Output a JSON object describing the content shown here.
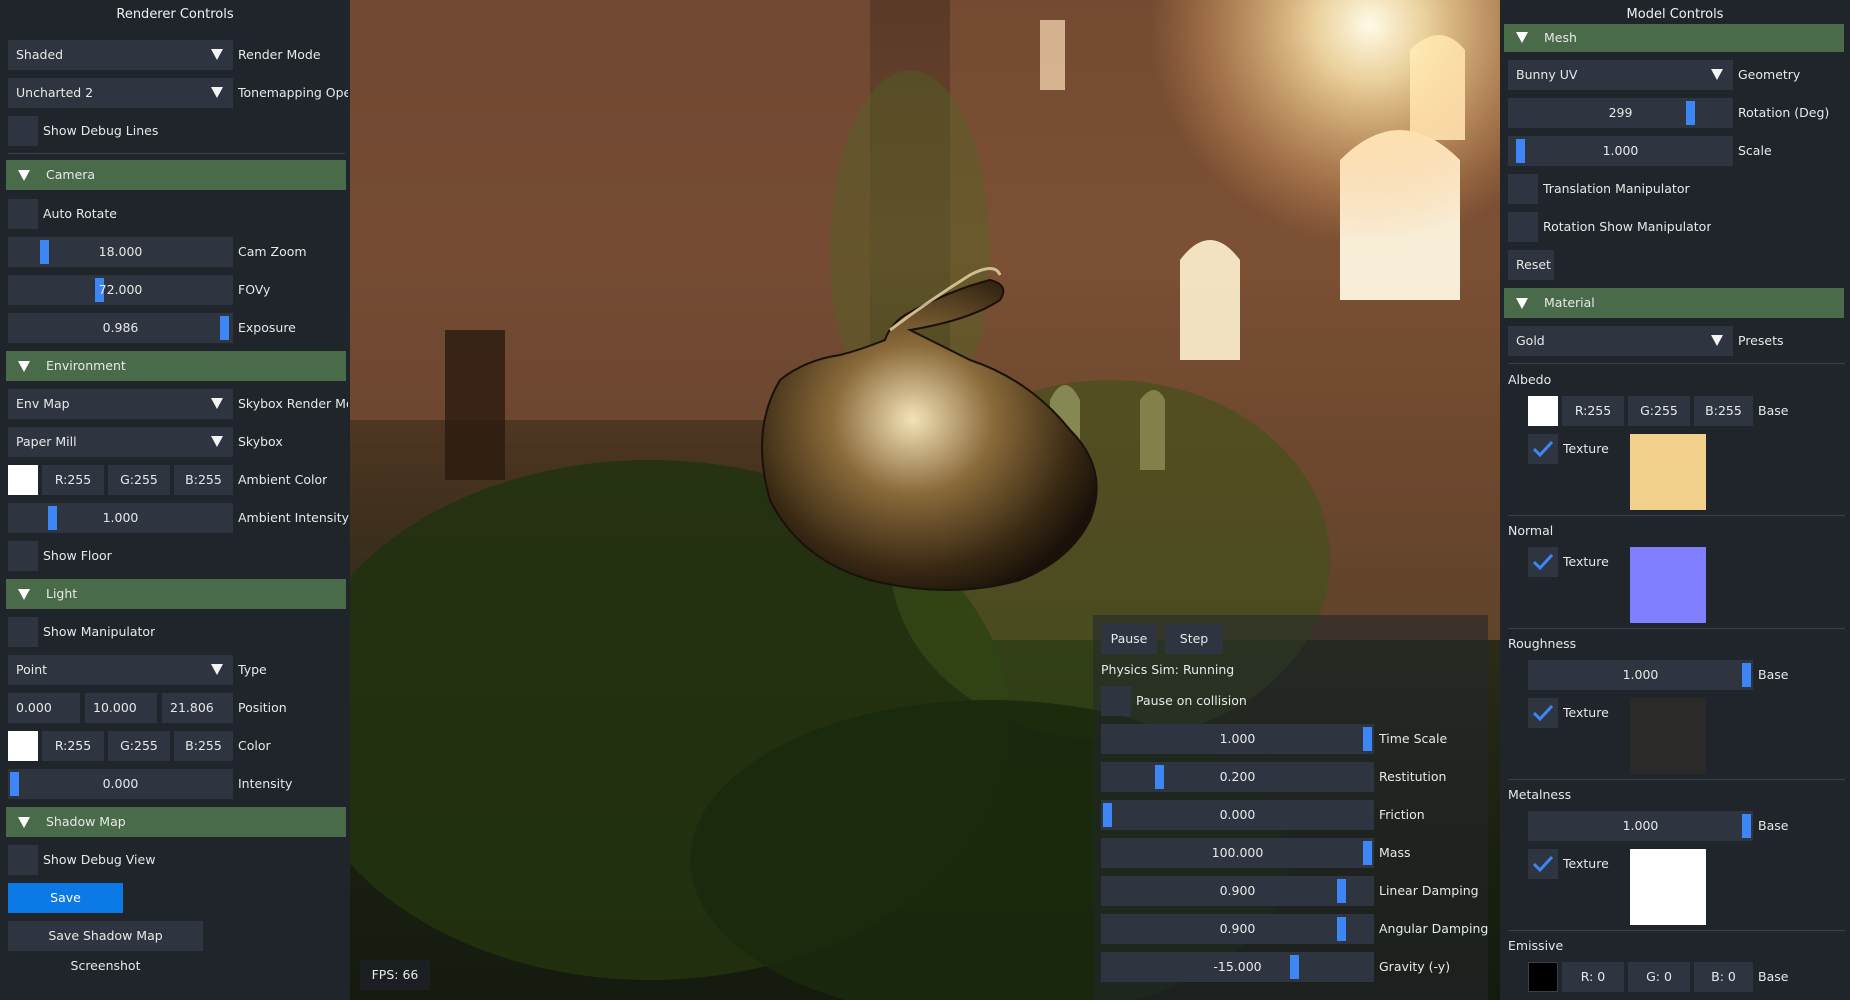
{
  "left": {
    "title": "Renderer Controls",
    "render_mode": {
      "value": "Shaded",
      "label": "Render Mode"
    },
    "tonemapping": {
      "value": "Uncharted 2",
      "label": "Tonemapping Ope"
    },
    "debug_lines": "Show Debug Lines",
    "camera": {
      "header": "Camera",
      "auto_rotate": "Auto Rotate",
      "zoom": {
        "value": "18.000",
        "label": "Cam Zoom",
        "fraction": 0.14
      },
      "fovy": {
        "value": "72.000",
        "label": "FOVy",
        "fraction": 0.4
      },
      "exposure": {
        "value": "0.986",
        "label": "Exposure",
        "fraction": 0.99
      }
    },
    "environment": {
      "header": "Environment",
      "skybox_mode": {
        "value": "Env Map",
        "label": "Skybox Render Mo"
      },
      "skybox": {
        "value": "Paper Mill",
        "label": "Skybox"
      },
      "ambient": {
        "r": "R:255",
        "g": "G:255",
        "b": "B:255",
        "label": "Ambient Color"
      },
      "ambient_intensity": {
        "value": "1.000",
        "label": "Ambient Intensity",
        "fraction": 0.18
      },
      "show_floor": "Show Floor"
    },
    "light": {
      "header": "Light",
      "show_manip": "Show Manipulator",
      "type": {
        "value": "Point",
        "label": "Type"
      },
      "position": {
        "x": "0.000",
        "y": "10.000",
        "z": "21.806",
        "label": "Position"
      },
      "color": {
        "r": "R:255",
        "g": "G:255",
        "b": "B:255",
        "label": "Color"
      },
      "intensity": {
        "value": "0.000",
        "label": "Intensity",
        "fraction": 0.0
      }
    },
    "shadow": {
      "header": "Shadow Map",
      "debug_view": "Show Debug View",
      "save_screenshot": "Save Screenshot",
      "save_shadow": "Save Shadow Map Screenshot"
    }
  },
  "viewport": {
    "fps": "FPS: 66"
  },
  "physics": {
    "pause": "Pause",
    "step": "Step",
    "status": "Physics Sim: Running",
    "pause_collision": "Pause on collision",
    "sliders": [
      {
        "value": "1.000",
        "label": "Time Scale",
        "fraction": 1.0
      },
      {
        "value": "0.200",
        "label": "Restitution",
        "fraction": 0.2
      },
      {
        "value": "0.000",
        "label": "Friction",
        "fraction": 0.0
      },
      {
        "value": "100.000",
        "label": "Mass",
        "fraction": 1.0
      },
      {
        "value": "0.900",
        "label": "Linear Damping",
        "fraction": 0.9
      },
      {
        "value": "0.900",
        "label": "Angular Damping",
        "fraction": 0.9
      },
      {
        "value": "-15.000",
        "label": "Gravity (-y)",
        "fraction": 0.72
      }
    ]
  },
  "right": {
    "title": "Model Controls",
    "mesh": {
      "header": "Mesh",
      "geometry": {
        "value": "Bunny UV",
        "label": "Geometry"
      },
      "rotation": {
        "value": "299",
        "label": "Rotation (Deg)",
        "fraction": 0.83
      },
      "scale": {
        "value": "1.000",
        "label": "Scale",
        "fraction": 0.03
      },
      "translation_manip": "Translation Manipulator",
      "rotation_manip": "Rotation Show Manipulator",
      "reset": "Reset"
    },
    "material": {
      "header": "Material",
      "presets": {
        "value": "Gold",
        "label": "Presets"
      },
      "albedo": {
        "title": "Albedo",
        "r": "R:255",
        "g": "G:255",
        "b": "B:255",
        "base": "Base",
        "texture": "Texture",
        "tex_color": "#f0d08a"
      },
      "normal": {
        "title": "Normal",
        "texture": "Texture",
        "tex_color": "#7f7fff"
      },
      "roughness": {
        "title": "Roughness",
        "value": "1.000",
        "base": "Base",
        "fraction": 1.0,
        "texture": "Texture",
        "tex_color": "#2c2a28"
      },
      "metalness": {
        "title": "Metalness",
        "value": "1.000",
        "base": "Base",
        "fraction": 1.0,
        "texture": "Texture",
        "tex_color": "#ffffff"
      },
      "emissive": {
        "title": "Emissive",
        "r": "R:  0",
        "g": "G:  0",
        "b": "B:  0",
        "base": "Base"
      }
    }
  }
}
